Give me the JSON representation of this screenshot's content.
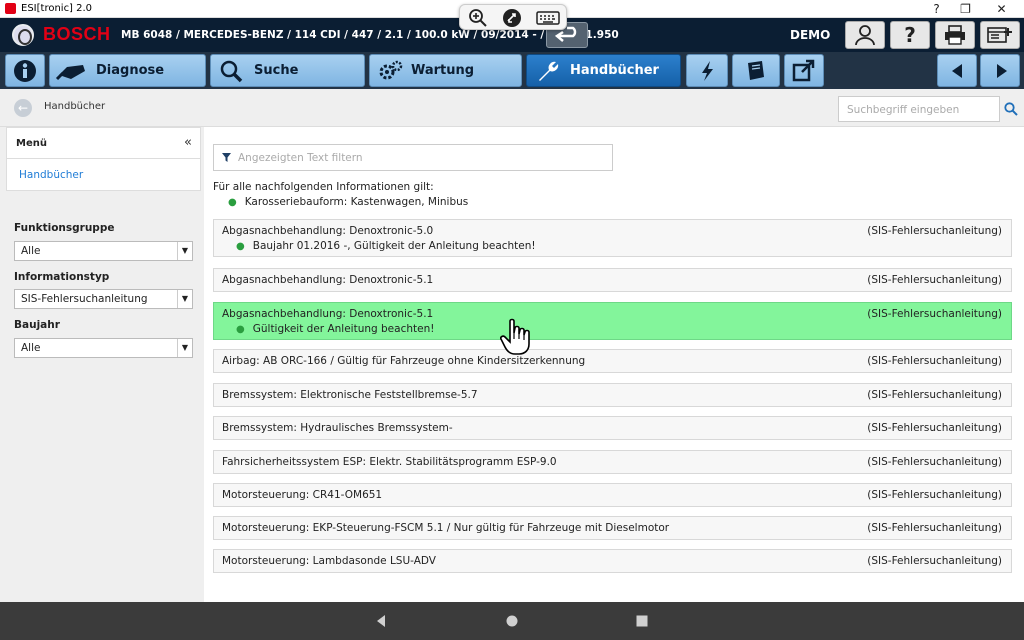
{
  "window": {
    "title": "ESI[tronic] 2.0",
    "controls": [
      "?",
      "❐",
      "✕"
    ]
  },
  "header": {
    "brand": "BOSCH",
    "vehicle": "MB 6048 / MERCEDES-BENZ / 114 CDI / 447 / 2.1 / 100.0 kW / 09/2014 - / OM 651.950",
    "mode": "DEMO",
    "help_label": "?"
  },
  "nav": {
    "tabs": [
      {
        "label": "Diagnose"
      },
      {
        "label": "Suche"
      },
      {
        "label": "Wartung"
      },
      {
        "label": "Handbücher"
      }
    ]
  },
  "breadcrumb": {
    "label": "Handbücher"
  },
  "search": {
    "placeholder": "Suchbegriff eingeben"
  },
  "sidebar": {
    "menu_title": "Menü",
    "collapse": "«",
    "menu_item": "Handbücher",
    "filters": [
      {
        "label": "Funktionsgruppe",
        "value": "Alle"
      },
      {
        "label": "Informationstyp",
        "value": "SIS-Fehlersuchanleitung"
      },
      {
        "label": "Baujahr",
        "value": "Alle"
      }
    ]
  },
  "content": {
    "filter_placeholder": "Angezeigten Text filtern",
    "intro": "Für alle nachfolgenden Informationen gilt:",
    "intro_item": "Karosseriebauform: Kastenwagen, Minibus",
    "rows": [
      {
        "title": "Abgasnachbehandlung: Denoxtronic-5.0",
        "category": "(SIS-Fehlersuchanleitung)",
        "sub": "Baujahr 01.2016 -, Gültigkeit der Anleitung beachten!"
      },
      {
        "title": "Abgasnachbehandlung: Denoxtronic-5.1",
        "category": "(SIS-Fehlersuchanleitung)"
      },
      {
        "title": "Abgasnachbehandlung: Denoxtronic-5.1",
        "category": "(SIS-Fehlersuchanleitung)",
        "sub": "Gültigkeit der Anleitung beachten!"
      },
      {
        "title": "Airbag: AB ORC-166 / Gültig für Fahrzeuge ohne Kindersitzerkennung",
        "category": "(SIS-Fehlersuchanleitung)"
      },
      {
        "title": "Bremssystem: Elektronische Feststellbremse-5.7",
        "category": "(SIS-Fehlersuchanleitung)"
      },
      {
        "title": "Bremssystem: Hydraulisches Bremssystem-",
        "category": "(SIS-Fehlersuchanleitung)"
      },
      {
        "title": "Fahrsicherheitssystem ESP: Elektr. Stabilitätsprogramm ESP-9.0",
        "category": "(SIS-Fehlersuchanleitung)"
      },
      {
        "title": "Motorsteuerung: CR41-OM651",
        "category": "(SIS-Fehlersuchanleitung)"
      },
      {
        "title": "Motorsteuerung: EKP-Steuerung-FSCM 5.1 / Nur gültig für Fahrzeuge mit Dieselmotor",
        "category": "(SIS-Fehlersuchanleitung)"
      },
      {
        "title": "Motorsteuerung: Lambdasonde LSU-ADV",
        "category": "(SIS-Fehlersuchanleitung)"
      }
    ]
  },
  "colors": {
    "highlight": "#83f59b",
    "active_tab": "#1d6fbd",
    "brand_red": "#e20015",
    "header_bg": "#0b1e33"
  }
}
